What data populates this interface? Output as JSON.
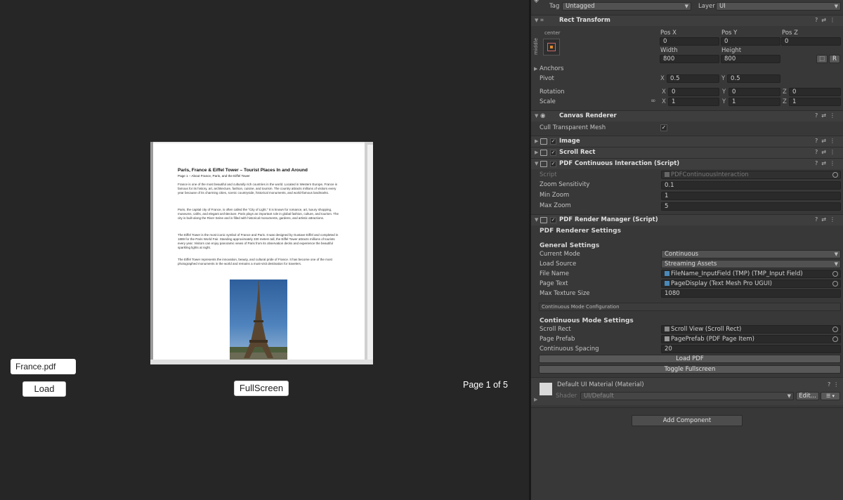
{
  "game": {
    "pdf": {
      "title": "Paris, France & Eiffel Tower – Tourist Places In and Around",
      "subtitle": "Page 1 – About France, Paris, and the Eiffel Tower",
      "paragraphs": [
        "France is one of the most beautiful and culturally rich countries in the world. Located in Western Europe, France is famous for its history, art, architecture, fashion, cuisine, and tourism. The country attracts millions of visitors every year because of its charming cities, scenic countryside, historical monuments, and world-famous landmarks.",
        "Paris, the capital city of France, is often called the \"City of Light.\" It is known for romance, art, luxury shopping, museums, cafés, and elegant architecture. Paris plays an important role in global fashion, culture, and tourism. The city is built along the River Seine and is filled with historical monuments, gardens, and artistic attractions.",
        "The Eiffel Tower is the most iconic symbol of France and Paris. It was designed by Gustave Eiffel and completed in 1889 for the Paris World Fair. Standing approximately 330 meters tall, the Eiffel Tower attracts millions of tourists every year. Visitors can enjoy panoramic views of Paris from its observation decks and experience the beautiful sparkling lights at night.",
        "The Eiffel Tower represents the innovation, beauty, and cultural pride of France. It has become one of the most photographed monuments in the world and remains a must-visit destination for travelers."
      ]
    },
    "file_input_value": "France.pdf",
    "load_label": "Load",
    "fullscreen_label": "FullScreen",
    "page_label": "Page 1 of 5"
  },
  "inspector": {
    "tag_label": "Tag",
    "tag_value": "Untagged",
    "layer_label": "Layer",
    "layer_value": "UI",
    "rect_transform": {
      "title": "Rect Transform",
      "anchor_h": "center",
      "anchor_v": "middle",
      "pos_x_label": "Pos X",
      "pos_x": "0",
      "pos_y_label": "Pos Y",
      "pos_y": "0",
      "pos_z_label": "Pos Z",
      "pos_z": "0",
      "width_label": "Width",
      "width": "800",
      "height_label": "Height",
      "height": "800",
      "anchors_label": "Anchors",
      "pivot_label": "Pivot",
      "pivot_x": "0.5",
      "pivot_y": "0.5",
      "rotation_label": "Rotation",
      "rot_x": "0",
      "rot_y": "0",
      "rot_z": "0",
      "scale_label": "Scale",
      "scale_x": "1",
      "scale_y": "1",
      "scale_z": "1",
      "x": "X",
      "y": "Y",
      "z": "Z",
      "r_btn": "R"
    },
    "canvas_renderer": {
      "title": "Canvas Renderer",
      "cull_label": "Cull Transparent Mesh",
      "cull_checked": true
    },
    "image": {
      "title": "Image"
    },
    "scroll_rect": {
      "title": "Scroll Rect"
    },
    "pdf_interaction": {
      "title": "PDF Continuous Interaction (Script)",
      "script_label": "Script",
      "script_value": "PDFContinuousInteraction",
      "zoom_sens_label": "Zoom Sensitivity",
      "zoom_sens": "0.1",
      "min_zoom_label": "Min Zoom",
      "min_zoom": "1",
      "max_zoom_label": "Max Zoom",
      "max_zoom": "5"
    },
    "pdf_render": {
      "title": "PDF Render Manager (Script)",
      "settings_header": "PDF Renderer Settings",
      "general_header": "General Settings",
      "current_mode_label": "Current Mode",
      "current_mode": "Continuous",
      "load_source_label": "Load Source",
      "load_source": "Streaming Assets",
      "file_name_label": "File Name",
      "file_name": "FileName_InputField (TMP) (TMP_Input Field)",
      "page_text_label": "Page Text",
      "page_text": "PageDisplay (Text Mesh Pro UGUI)",
      "max_tex_label": "Max Texture Size",
      "max_tex": "1080",
      "config_tab": "Continuous Mode Configuration",
      "continuous_header": "Continuous Mode Settings",
      "scroll_rect_label": "Scroll Rect",
      "scroll_rect": "Scroll View (Scroll Rect)",
      "page_prefab_label": "Page Prefab",
      "page_prefab": "PagePrefab (PDF Page Item)",
      "spacing_label": "Continuous Spacing",
      "spacing": "20",
      "load_pdf_btn": "Load PDF",
      "toggle_fullscreen_btn": "Toggle Fullscreen"
    },
    "material": {
      "title": "Default UI Material (Material)",
      "shader_label": "Shader",
      "shader_value": "UI/Default",
      "edit_btn": "Edit..."
    },
    "add_component": "Add Component",
    "colors": {
      "panel": "#383838",
      "field": "#2a2a2a",
      "header": "#3e3e3e",
      "accent": "#4a89b8"
    },
    "icons": [
      "help-icon",
      "preset-icon",
      "kebab-menu-icon",
      "link-icon",
      "object-picker-icon"
    ]
  }
}
